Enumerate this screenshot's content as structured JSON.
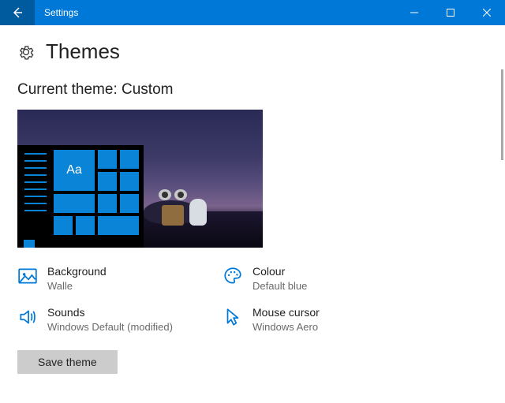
{
  "titlebar": {
    "title": "Settings"
  },
  "page": {
    "title": "Themes"
  },
  "current_theme": {
    "label_prefix": "Current theme: ",
    "name": "Custom",
    "preview_tile_text": "Aa"
  },
  "settings": {
    "background": {
      "label": "Background",
      "value": "Walle"
    },
    "colour": {
      "label": "Colour",
      "value": "Default blue"
    },
    "sounds": {
      "label": "Sounds",
      "value": "Windows Default (modified)"
    },
    "cursor": {
      "label": "Mouse cursor",
      "value": "Windows Aero"
    }
  },
  "actions": {
    "save_theme": "Save theme"
  },
  "colors": {
    "accent": "#0078d7"
  }
}
